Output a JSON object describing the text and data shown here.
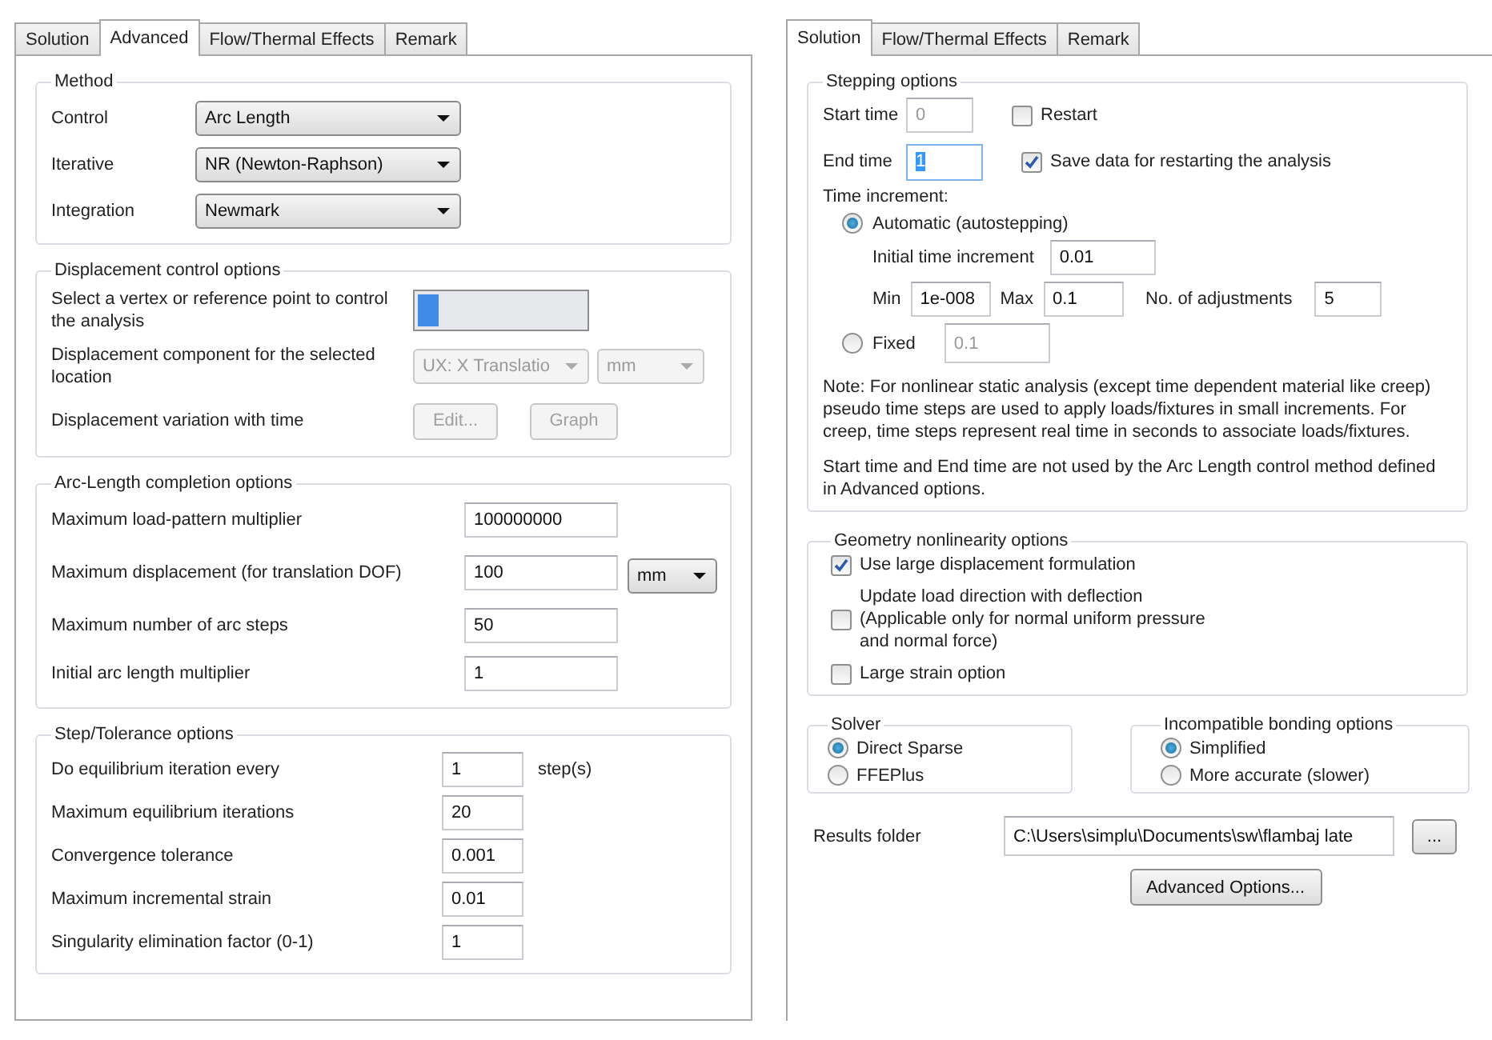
{
  "left_panel": {
    "tabs": [
      {
        "label": "Solution",
        "selected": false
      },
      {
        "label": "Advanced",
        "selected": true
      },
      {
        "label": "Flow/Thermal Effects",
        "selected": false
      },
      {
        "label": "Remark",
        "selected": false
      }
    ],
    "groups": [
      {
        "title": "Method",
        "rows": [
          {
            "kind": "select",
            "label": "Control",
            "value": "Arc Length"
          },
          {
            "kind": "select",
            "label": "Iterative",
            "value": "NR (Newton-Raphson)"
          },
          {
            "kind": "select",
            "label": "Integration",
            "value": "Newmark"
          }
        ]
      },
      {
        "title": "Displacement control options",
        "rows": [
          {
            "kind": "vertex",
            "label": "Select a vertex or reference point to control the analysis"
          },
          {
            "kind": "select_pair",
            "label": "Displacement component for the selected location",
            "values": [
              "UX: X Translatio",
              "mm"
            ],
            "disabled": true
          },
          {
            "kind": "buttons",
            "label": "Displacement variation with time",
            "buttons": [
              "Edit...",
              "Graph"
            ],
            "disabled": true
          }
        ]
      },
      {
        "title": "Arc-Length completion options",
        "rows": [
          {
            "kind": "field",
            "label": "Maximum load-pattern multiplier",
            "value": "100000000"
          },
          {
            "kind": "field_unit",
            "label": "Maximum displacement (for translation DOF)",
            "value": "100",
            "unit": "mm"
          },
          {
            "kind": "field",
            "label": "Maximum number of arc steps",
            "value": "50"
          },
          {
            "kind": "field",
            "label": "Initial arc length multiplier",
            "value": "1"
          }
        ]
      },
      {
        "title": "Step/Tolerance options",
        "rows": [
          {
            "kind": "field_suffix",
            "label": "Do equilibrium iteration every",
            "value": "1",
            "suffix": "step(s)"
          },
          {
            "kind": "field",
            "label": "Maximum equilibrium iterations",
            "value": "20"
          },
          {
            "kind": "field",
            "label": "Convergence tolerance",
            "value": "0.001"
          },
          {
            "kind": "field",
            "label": "Maximum incremental strain",
            "value": "0.01"
          },
          {
            "kind": "field",
            "label": "Singularity elimination factor (0-1)",
            "value": "1"
          }
        ]
      }
    ]
  },
  "right_panel": {
    "tabs": [
      {
        "label": "Solution",
        "selected": true
      },
      {
        "label": "Flow/Thermal Effects",
        "selected": false
      },
      {
        "label": "Remark",
        "selected": false
      }
    ],
    "stepping": {
      "title": "Stepping options",
      "start_time": {
        "label": "Start time",
        "value": "0",
        "disabled": true
      },
      "end_time": {
        "label": "End time",
        "value": "1",
        "highlighted": true
      },
      "checks": [
        {
          "label": "Restart",
          "checked": false
        },
        {
          "label": "Save data for restarting the analysis",
          "checked": true
        }
      ],
      "increment_label": "Time increment:",
      "automatic": {
        "label": "Automatic (autostepping)",
        "selected": true
      },
      "initial": {
        "label": "Initial time increment",
        "value": "0.01"
      },
      "min": {
        "label": "Min",
        "value": "1e-008"
      },
      "max": {
        "label": "Max",
        "value": "0.1"
      },
      "adjustments": {
        "label": "No. of adjustments",
        "value": "5"
      },
      "fixed": {
        "label": "Fixed",
        "selected": false,
        "value": "0.1",
        "disabled": true
      },
      "notes": [
        "Note: For nonlinear static analysis (except time dependent material like creep) pseudo time steps are used to apply loads/fixtures in small increments. For creep, time steps represent real time in seconds to associate loads/fixtures.",
        "Start time and End time  are not used by the Arc Length control method defined in Advanced options."
      ]
    },
    "geometry": {
      "title": "Geometry nonlinearity options",
      "options": [
        {
          "label": "Use large displacement formulation",
          "checked": true
        },
        {
          "label": "Update load direction with deflection\n(Applicable only for normal uniform pressure\nand normal force)",
          "checked": false
        },
        {
          "label": "Large strain option",
          "checked": false
        }
      ]
    },
    "solver": {
      "title": "Solver",
      "options": [
        {
          "label": "Direct Sparse",
          "selected": true
        },
        {
          "label": "FFEPlus",
          "selected": false
        }
      ]
    },
    "bonding": {
      "title": "Incompatible bonding options",
      "options": [
        {
          "label": "Simplified",
          "selected": true
        },
        {
          "label": "More accurate (slower)",
          "selected": false
        }
      ]
    },
    "results": {
      "label": "Results folder",
      "value": "C:\\Users\\simplu\\Documents\\sw\\flambaj late",
      "browse": "..."
    },
    "advanced_button": "Advanced Options..."
  }
}
